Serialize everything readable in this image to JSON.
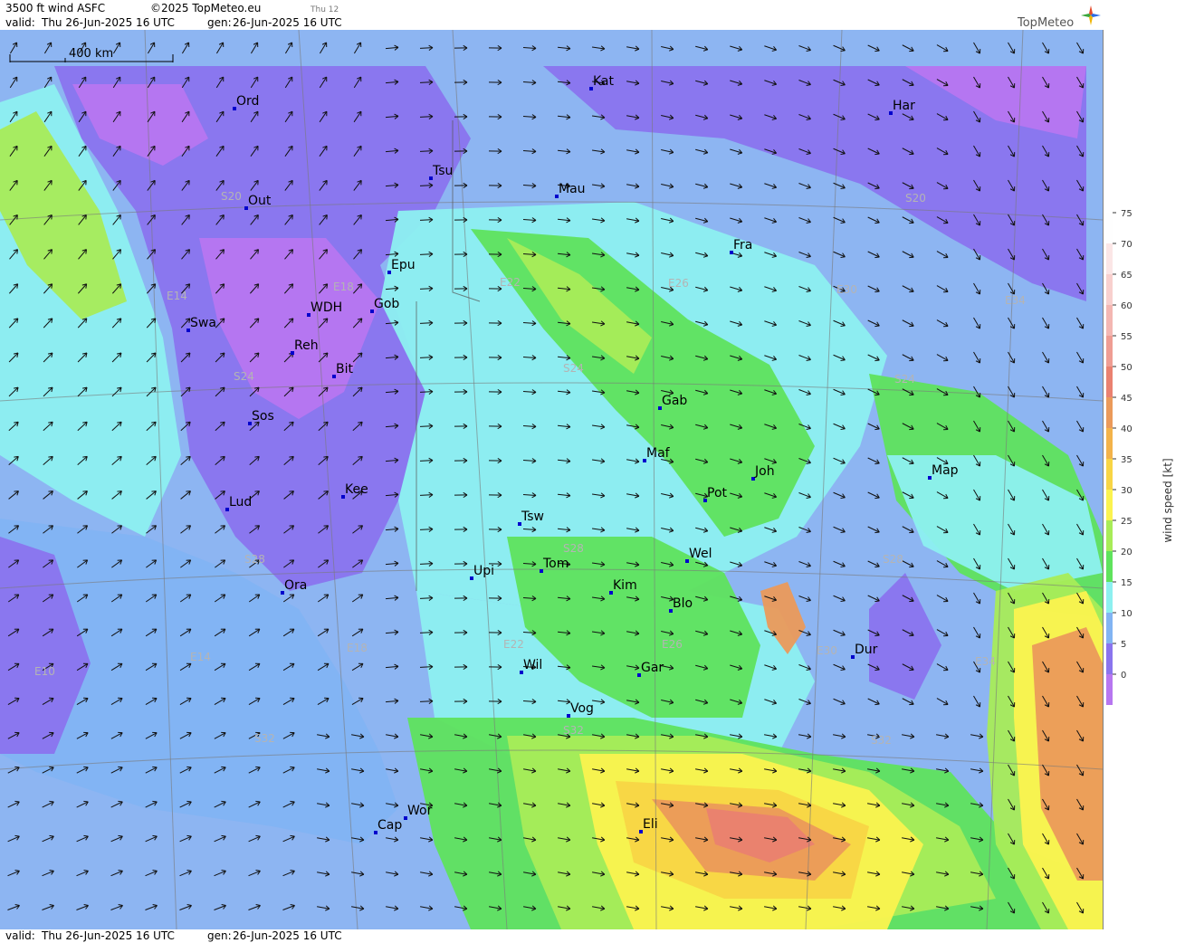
{
  "header": {
    "title": "3500 ft wind ASFC",
    "copyright": "©2025 TopMeteo.eu",
    "day_short": "Thu 12",
    "valid_label": "valid:",
    "valid_value": "Thu  26-Jun-2025  16 UTC",
    "gen_label": "gen:",
    "gen_value": "26-Jun-2025 16 UTC",
    "brand": "TopMeteo"
  },
  "footer": {
    "valid_label": "valid:",
    "valid_value": "Thu  26-Jun-2025  16 UTC",
    "gen_label": "gen:",
    "gen_value": "26-Jun-2025 16 UTC"
  },
  "scale_bar": {
    "label": "400 km"
  },
  "legend": {
    "title": "wind speed [kt]",
    "ticks": [
      "75",
      "70",
      "65",
      "60",
      "55",
      "50",
      "45",
      "40",
      "35",
      "30",
      "25",
      "20",
      "15",
      "10",
      "5",
      "0"
    ],
    "colors": [
      "#fefefe",
      "#fbe6e6",
      "#f8d0ce",
      "#f4b7b2",
      "#ef9d93",
      "#ea8170",
      "#eb9a5a",
      "#f3b34a",
      "#f8d545",
      "#fbf34f",
      "#a8ec58",
      "#5fe35d",
      "#8df0f0",
      "#82b4f3",
      "#8a74ee",
      "#b776f0"
    ]
  },
  "cities": [
    {
      "name": "Ord"
    },
    {
      "name": "Kat"
    },
    {
      "name": "Har"
    },
    {
      "name": "Tsu"
    },
    {
      "name": "Out"
    },
    {
      "name": "Mau"
    },
    {
      "name": "Fra"
    },
    {
      "name": "Epu"
    },
    {
      "name": "Gob"
    },
    {
      "name": "WDH"
    },
    {
      "name": "Swa"
    },
    {
      "name": "Reh"
    },
    {
      "name": "Bit"
    },
    {
      "name": "Sos"
    },
    {
      "name": "Gab"
    },
    {
      "name": "Maf"
    },
    {
      "name": "Joh"
    },
    {
      "name": "Map"
    },
    {
      "name": "Kee"
    },
    {
      "name": "Lud"
    },
    {
      "name": "Pot"
    },
    {
      "name": "Tsw"
    },
    {
      "name": "Wel"
    },
    {
      "name": "Upi"
    },
    {
      "name": "Tom"
    },
    {
      "name": "Kim"
    },
    {
      "name": "Blo"
    },
    {
      "name": "Ora"
    },
    {
      "name": "Dur"
    },
    {
      "name": "Wil"
    },
    {
      "name": "Gar"
    },
    {
      "name": "Vog"
    },
    {
      "name": "Wor"
    },
    {
      "name": "Cap"
    },
    {
      "name": "Eli"
    }
  ],
  "grid_labels": [
    {
      "text": "S20"
    },
    {
      "text": "S20"
    },
    {
      "text": "E14"
    },
    {
      "text": "E18"
    },
    {
      "text": "E22"
    },
    {
      "text": "E26"
    },
    {
      "text": "E30"
    },
    {
      "text": "E34"
    },
    {
      "text": "S24"
    },
    {
      "text": "S24"
    },
    {
      "text": "S24"
    },
    {
      "text": "S28"
    },
    {
      "text": "S28"
    },
    {
      "text": "S28"
    },
    {
      "text": "E10"
    },
    {
      "text": "E14"
    },
    {
      "text": "E18"
    },
    {
      "text": "E22"
    },
    {
      "text": "E26"
    },
    {
      "text": "E30"
    },
    {
      "text": "E34"
    },
    {
      "text": "S32"
    },
    {
      "text": "S32"
    },
    {
      "text": "S32"
    }
  ]
}
